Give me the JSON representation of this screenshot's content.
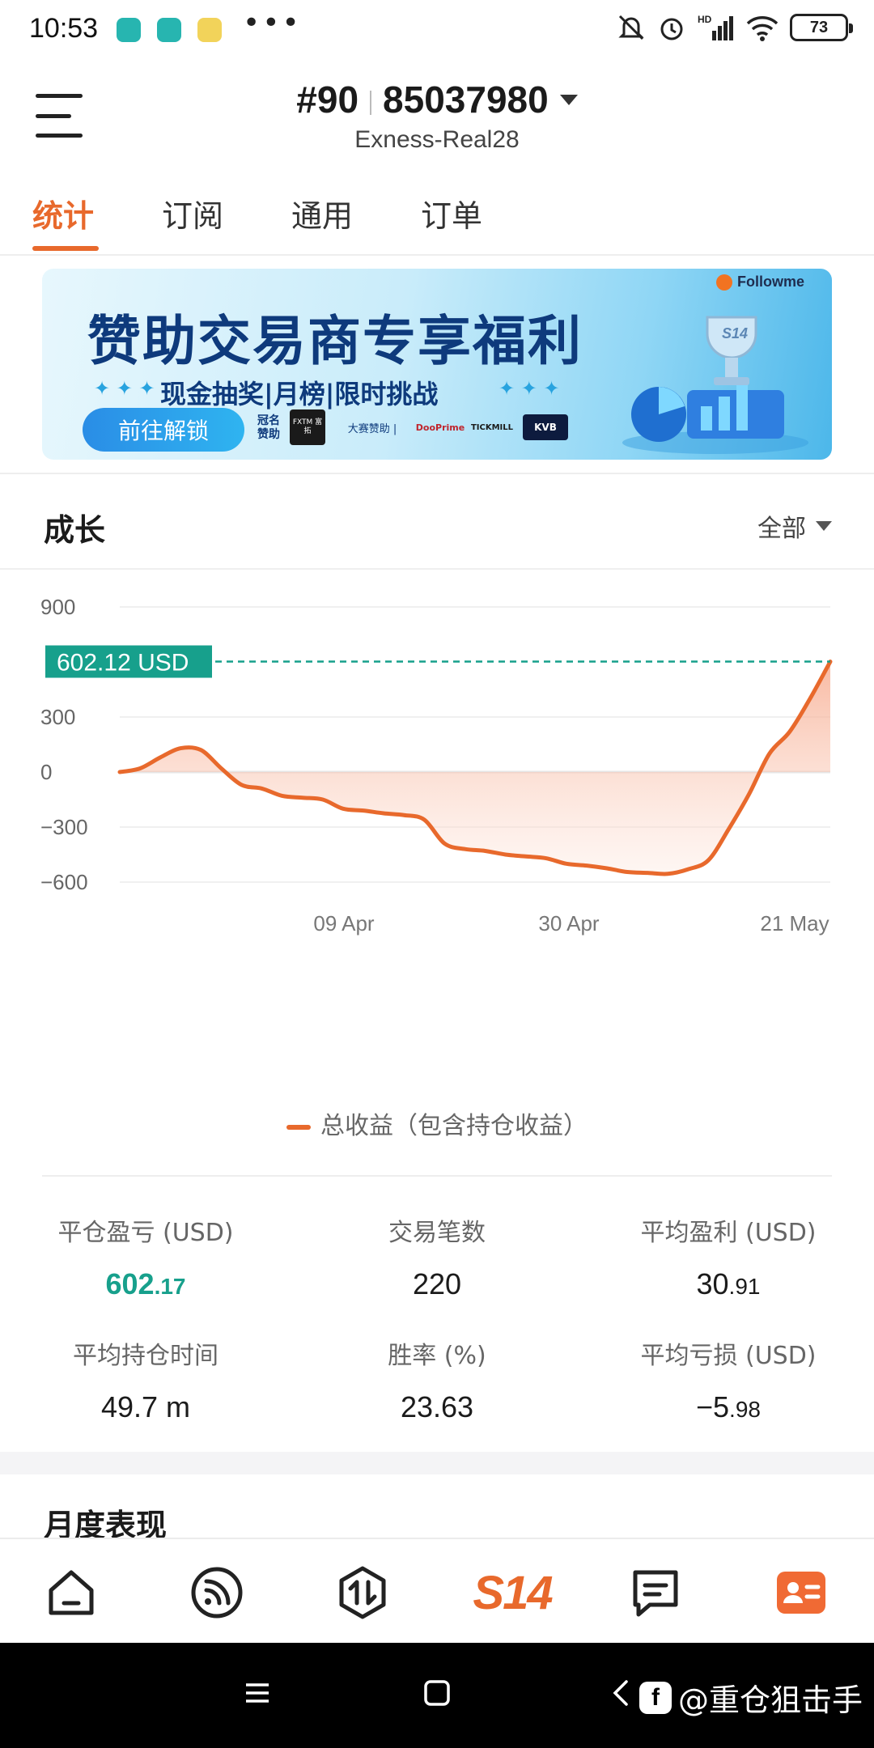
{
  "status_bar": {
    "time": "10:53",
    "battery": "73",
    "network": "HD"
  },
  "header": {
    "account_prefix": "#90",
    "account_id": "85037980",
    "server": "Exness-Real28"
  },
  "tabs": [
    {
      "label": "统计",
      "active": true
    },
    {
      "label": "订阅",
      "active": false
    },
    {
      "label": "通用",
      "active": false
    },
    {
      "label": "订单",
      "active": false
    }
  ],
  "banner": {
    "brand": "Followme",
    "title": "赞助交易商专享福利",
    "subtitle": "现金抽奖|月榜|限时挑战",
    "button": "前往解锁",
    "sponsor_label": "冠名 赞助",
    "sponsors": [
      "FXTM 富拓",
      "大赛赞助 |",
      "DooPrime",
      "TICKMILL",
      "KVB"
    ]
  },
  "growth": {
    "title": "成长",
    "filter": "全部",
    "legend": "总收益（包含持仓收益）"
  },
  "chart_data": {
    "type": "area",
    "series": [
      {
        "name": "总收益（包含持仓收益）"
      }
    ],
    "current_value_label": "602.12 USD",
    "current_value": 602.12,
    "y_ticks": [
      "900",
      "300",
      "0",
      "−300",
      "−600"
    ],
    "x_tick_labels": [
      "09 Apr",
      "30 Apr",
      "21 May"
    ],
    "ylim": [
      -600,
      900
    ],
    "y": [
      0,
      20,
      80,
      130,
      120,
      20,
      -70,
      -90,
      -130,
      -140,
      -150,
      -200,
      -210,
      -225,
      -235,
      -260,
      -390,
      -420,
      -430,
      -450,
      -460,
      -470,
      -500,
      -510,
      -525,
      -545,
      -550,
      -555,
      -530,
      -480,
      -310,
      -120,
      100,
      220,
      400,
      602.12
    ],
    "colors": {
      "line": "#e8692c",
      "fill": "#fbd5c3",
      "marker": "#17a08c"
    }
  },
  "stats": {
    "closed_pnl_label": "平仓盈亏 (USD)",
    "closed_pnl_int": "602",
    "closed_pnl_dec": ".17",
    "trades_label": "交易笔数",
    "trades_value": "220",
    "avg_profit_label": "平均盈利 (USD)",
    "avg_profit_int": "30",
    "avg_profit_dec": ".91",
    "avg_hold_label": "平均持仓时间",
    "avg_hold_value": "49.7 m",
    "win_rate_label": "胜率 (%)",
    "win_rate_value": "23.63",
    "avg_loss_label": "平均亏损 (USD)",
    "avg_loss_int": "−5",
    "avg_loss_dec": ".98"
  },
  "monthly": {
    "title": "月度表现"
  },
  "bottom_nav": {
    "s14_label": "S14"
  },
  "system_nav": {
    "watermark": "@重仓狙击手"
  }
}
